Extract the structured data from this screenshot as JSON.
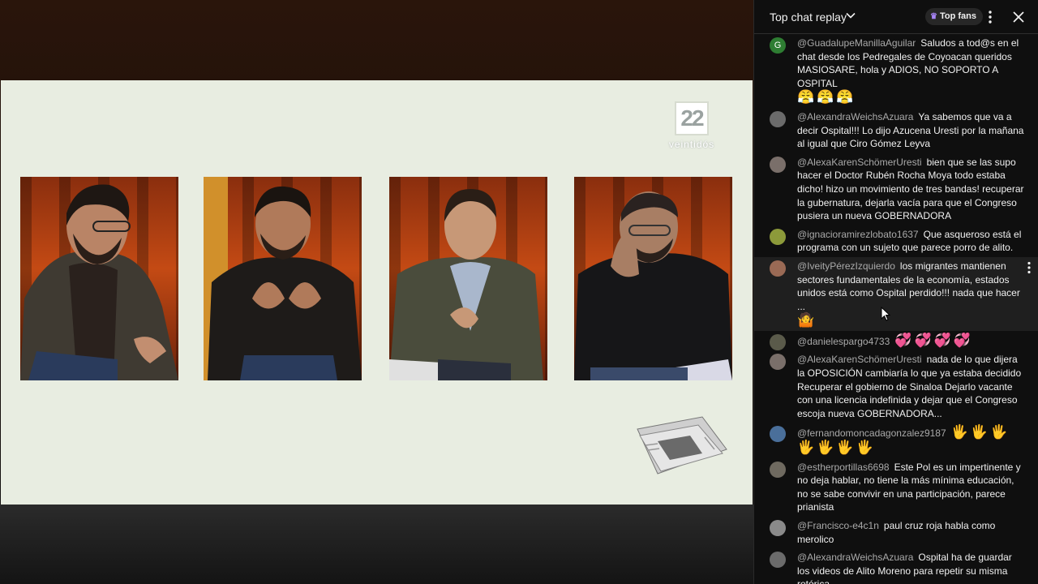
{
  "video": {
    "logo": {
      "number": "22",
      "wordmark": "veintidós"
    }
  },
  "chat": {
    "header": {
      "title": "Top chat replay",
      "top_fans_label": "Top fans",
      "icons": [
        "chevron-down-icon",
        "crown-icon",
        "more-vert-icon",
        "close-icon"
      ]
    },
    "messages": [
      {
        "author": "@GuadalupeManillaAguilar",
        "text": "Saludos a tod@s en el chat desde los Pedregales de Coyoacan queridos MASIOSARE, hola y ADIOS, NO SOPORTO A OSPITAL",
        "emoji": [
          "😤",
          "😤",
          "😤"
        ],
        "avatar_letter": "G",
        "avatar_color": "#2e7d32"
      },
      {
        "author": "@AlexandraWeichsAzuara",
        "text": "Ya sabemos que va a decir Ospital!!! Lo dijo Azucena Uresti por la mañana al igual que Ciro Gómez Leyva",
        "emoji": [],
        "avatar_letter": "",
        "avatar_color": "#6b6b6b"
      },
      {
        "author": "@AlexaKarenSchömerUresti",
        "text": "bien que se las supo hacer el Doctor Rubén Rocha Moya todo estaba dicho! hizo un movimiento de tres bandas! recuperar la gubernatura, dejarla vacía para que el Congreso pusiera un nueva GOBERNADORA",
        "emoji": [],
        "avatar_letter": "",
        "avatar_color": "#7a6f6a"
      },
      {
        "author": "@ignacioramirezlobato1637",
        "text": "Que asqueroso está el programa con un sujeto que parece porro de alito.",
        "emoji": [],
        "avatar_letter": "",
        "avatar_color": "#8c9a3a"
      },
      {
        "author": "@IveityPérezIzquierdo",
        "text": "los migrantes mantienen sectores fundamentales de la economía, estados unidos está como Ospital perdido!!! nada que hacer ...",
        "emoji": [
          "🤷"
        ],
        "avatar_letter": "",
        "avatar_color": "#9a6a55"
      },
      {
        "author": "@danielespargo4733",
        "text": "",
        "emoji": [
          "💞",
          "💞",
          "💞",
          "💞"
        ],
        "avatar_letter": "",
        "avatar_color": "#5a5a4a"
      },
      {
        "author": "@AlexaKarenSchömerUresti",
        "text": "nada de lo que dijera la OPOSICIÓN cambiaría lo que ya estaba decidido Recuperar el gobierno de Sinaloa Dejarlo vacante con una licencia indefinida y dejar que el Congreso escoja nueva GOBERNADORA...",
        "emoji": [],
        "avatar_letter": "",
        "avatar_color": "#7a6f6a"
      },
      {
        "author": "@fernandomoncadagonzalez9187",
        "text": "",
        "emoji": [
          "🖐",
          "🖐",
          "🖐",
          "🖐",
          "🖐",
          "🖐",
          "🖐"
        ],
        "avatar_letter": "",
        "avatar_color": "#4a6f9a"
      },
      {
        "author": "@estherportillas6698",
        "text": "Este Pol es un impertinente y no deja hablar, no tiene la más mínima educación, no se sabe convivir en una participación, parece prianista",
        "emoji": [],
        "avatar_letter": "",
        "avatar_color": "#6f6a60"
      },
      {
        "author": "@Francisco-e4c1n",
        "text": "paul cruz roja habla como merolico",
        "emoji": [],
        "avatar_letter": "",
        "avatar_color": "#8a8a8a"
      },
      {
        "author": "@AlexandraWeichsAzuara",
        "text": "Ospital ha de guardar los videos de Alito Moreno para repetir su misma retórica",
        "emoji": [],
        "avatar_letter": "",
        "avatar_color": "#6b6b6b"
      }
    ]
  }
}
